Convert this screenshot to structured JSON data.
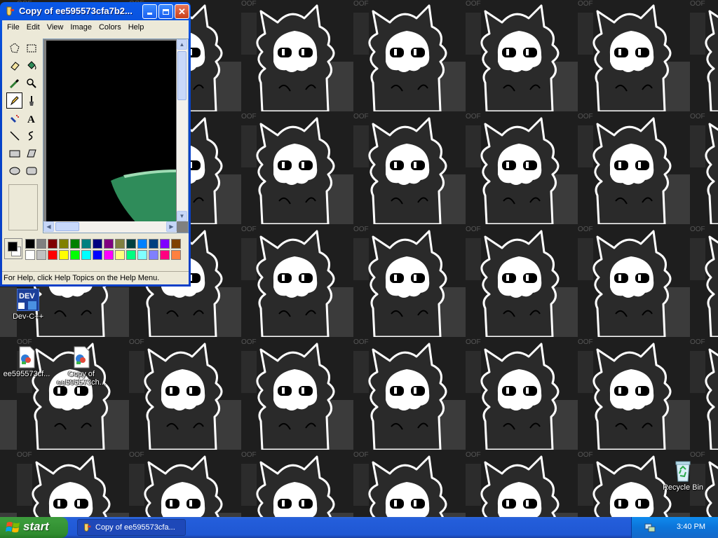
{
  "window": {
    "title": "Copy of ee595573cfa7b2...",
    "menu": [
      "File",
      "Edit",
      "View",
      "Image",
      "Colors",
      "Help"
    ],
    "status": "For Help, click Help Topics on the Help Menu."
  },
  "tools": [
    {
      "icon": "free-select-icon"
    },
    {
      "icon": "rect-select-icon"
    },
    {
      "icon": "eraser-icon"
    },
    {
      "icon": "fill-bucket-icon"
    },
    {
      "icon": "color-picker-icon"
    },
    {
      "icon": "magnifier-icon"
    },
    {
      "icon": "pencil-icon",
      "selected": true
    },
    {
      "icon": "brush-icon"
    },
    {
      "icon": "airbrush-icon"
    },
    {
      "icon": "text-icon"
    },
    {
      "icon": "line-icon"
    },
    {
      "icon": "curve-icon"
    },
    {
      "icon": "rectangle-icon"
    },
    {
      "icon": "polygon-icon"
    },
    {
      "icon": "ellipse-icon"
    },
    {
      "icon": "rounded-rect-icon"
    }
  ],
  "palette": {
    "foreground": "#000000",
    "background": "#ffffff",
    "row1": [
      "#000000",
      "#808080",
      "#800000",
      "#808000",
      "#008000",
      "#008080",
      "#000080",
      "#800080",
      "#808040",
      "#004040",
      "#0080ff",
      "#004080",
      "#8000ff",
      "#804000"
    ],
    "row2": [
      "#ffffff",
      "#c0c0c0",
      "#ff0000",
      "#ffff00",
      "#00ff00",
      "#00ffff",
      "#0000ff",
      "#ff00ff",
      "#ffff80",
      "#00ff80",
      "#80ffff",
      "#8080ff",
      "#ff0080",
      "#ff8040"
    ]
  },
  "desktop_icons": [
    {
      "label": "Dev-C++",
      "badge": "DEV"
    },
    {
      "label": "ee595573cf..."
    },
    {
      "label": "Copy of ee595573ch..."
    },
    {
      "label": "Recycle Bin"
    }
  ],
  "wallpaper_watermark": "OOF",
  "taskbar": {
    "start": "start",
    "task_label": "Copy of ee595573cfa...",
    "clock": "3:40 PM"
  }
}
